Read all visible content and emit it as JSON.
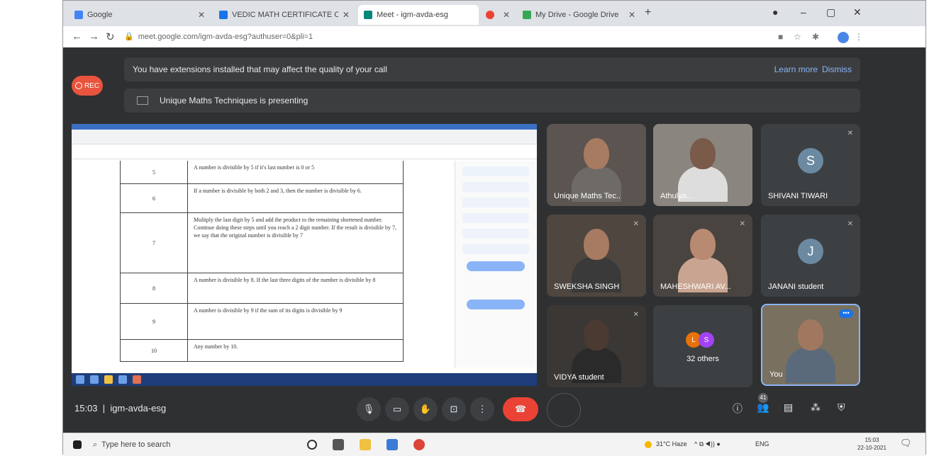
{
  "browser": {
    "tabs": [
      {
        "label": "Google",
        "active": false,
        "color": "#4285f4"
      },
      {
        "label": "VEDIC MATH CERTIFICATE COU",
        "active": false,
        "color": "#1a73e8"
      },
      {
        "label": "Meet - igm-avda-esg",
        "active": true,
        "color": "#00897b"
      },
      {
        "label": "",
        "active": false,
        "color": "#ea4335"
      },
      {
        "label": "My Drive - Google Drive",
        "active": false,
        "color": "#34a853"
      }
    ],
    "url": "meet.google.com/igm-avda-esg?authuser=0&pli=1"
  },
  "meet": {
    "rec_label": "REC",
    "banner_text": "You have extensions installed that may affect the quality of your call",
    "learn_more": "Learn more",
    "dismiss": "Dismiss",
    "presenting_text": "Unique Maths Techniques is presenting",
    "document_rows": [
      {
        "num": "5",
        "text": "A number is divisible by 5 if it's last number is 0 or 5"
      },
      {
        "num": "6",
        "text": "If a number is divisible by both 2 and 3, then the number is divisible by 6."
      },
      {
        "num": "7",
        "text": "Multiply the last digit by 5 and add the product to the remaining shortened number. Continue doing these steps until you reach a 2 digit number. If the result is divisible by 7, we say that the original number is divisible by 7"
      },
      {
        "num": "8",
        "text": "A number is divisible by 8. If the last three digits of the number is divisible by 8"
      },
      {
        "num": "9",
        "text": "A number is divisible by 9 if the sum of its digits is divisible by 9"
      },
      {
        "num": "10",
        "text": "Any number by 10."
      }
    ],
    "participants": [
      {
        "name": "Unique Maths Tec..",
        "type": "photo"
      },
      {
        "name": "Athulya...",
        "type": "photo"
      },
      {
        "name": "SHIVANI TIWARI",
        "type": "initial",
        "initial": "S"
      },
      {
        "name": "SWEKSHA SINGH",
        "type": "photo"
      },
      {
        "name": "MAHESHWARI AV...",
        "type": "photo"
      },
      {
        "name": "JANANI student",
        "type": "initial",
        "initial": "J"
      },
      {
        "name": "VIDYA student",
        "type": "photo"
      },
      {
        "name": "32 others",
        "type": "others",
        "initials": [
          "L",
          "S"
        ]
      },
      {
        "name": "You",
        "type": "self"
      }
    ],
    "meeting_time": "15:03",
    "meeting_code": "igm-avda-esg",
    "people_count": "41"
  },
  "os": {
    "search_placeholder": "Type here to search",
    "weather": "31°C Haze",
    "lang": "ENG",
    "time": "15:03",
    "date": "22-10-2021"
  },
  "colors": {
    "end_call": "#ea4335",
    "rec": "#e8543d",
    "link": "#8ab4f8"
  }
}
